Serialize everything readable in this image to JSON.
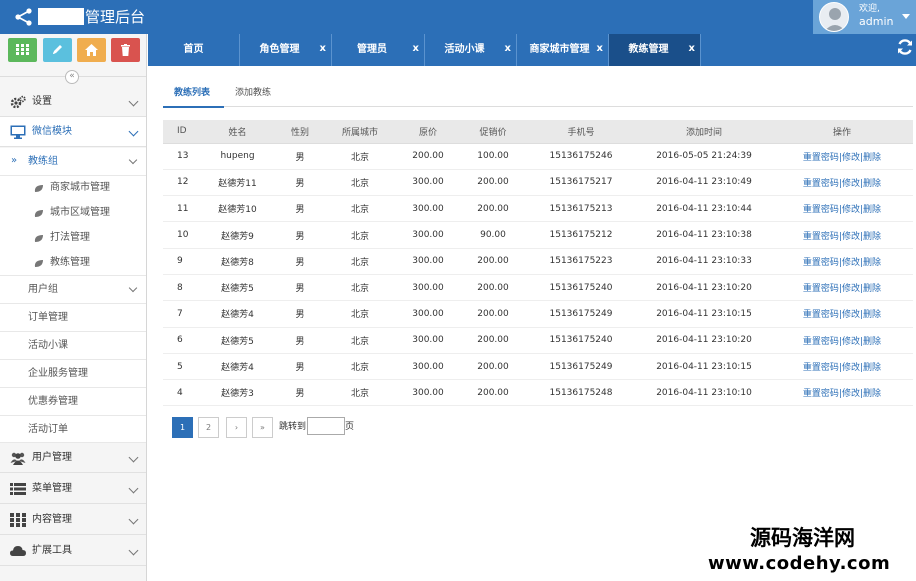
{
  "header": {
    "brand_suffix": "管理后台",
    "user_welcome": "欢迎,",
    "user_name": "admin"
  },
  "colors": {
    "primary": "#2c6fb7",
    "primary_dark": "#1a4f8a",
    "btn_green": "#5cb85c",
    "btn_blue": "#5bc0de",
    "btn_orange": "#f0ad4e",
    "btn_red": "#d9534f"
  },
  "shortcuts": [
    {
      "icon": "grid-icon",
      "color": "#5cb85c"
    },
    {
      "icon": "pencil-icon",
      "color": "#5bc0de"
    },
    {
      "icon": "home-icon",
      "color": "#f0ad4e"
    },
    {
      "icon": "trash-icon",
      "color": "#d9534f"
    }
  ],
  "sidebar": {
    "settings": "设置",
    "wechat": "微信模块",
    "coach_group": "教练组",
    "coach_leaves": [
      "商家城市管理",
      "城市区域管理",
      "打法管理",
      "教练管理"
    ],
    "user_group": "用户组",
    "order_mgmt": "订单管理",
    "activity_class": "活动小课",
    "enterprise_service": "企业服务管理",
    "coupon_mgmt": "优惠券管理",
    "activity_order": "活动订单",
    "user_mgmt": "用户管理",
    "menu_mgmt": "菜单管理",
    "content_mgmt": "内容管理",
    "ext_tools": "扩展工具"
  },
  "tabs": [
    {
      "label": "首页",
      "closable": false
    },
    {
      "label": "角色管理",
      "closable": true
    },
    {
      "label": "管理员",
      "closable": true
    },
    {
      "label": "活动小课",
      "closable": true
    },
    {
      "label": "商家城市管理",
      "closable": true
    },
    {
      "label": "教练管理",
      "closable": true,
      "active": true
    }
  ],
  "tab_close": "x",
  "content_tabs": {
    "list": "教练列表",
    "add": "添加教练"
  },
  "table": {
    "headers": [
      "ID",
      "姓名",
      "性别",
      "所属城市",
      "原价",
      "促销价",
      "手机号",
      "添加时间",
      "操作"
    ],
    "rows": [
      [
        "13",
        "hupeng",
        "男",
        "北京",
        "200.00",
        "100.00",
        "15136175246",
        "2016-05-05 21:24:39"
      ],
      [
        "12",
        "赵德芳11",
        "男",
        "北京",
        "300.00",
        "200.00",
        "15136175217",
        "2016-04-11 23:10:49"
      ],
      [
        "11",
        "赵德芳10",
        "男",
        "北京",
        "300.00",
        "200.00",
        "15136175213",
        "2016-04-11 23:10:44"
      ],
      [
        "10",
        "赵德芳9",
        "男",
        "北京",
        "300.00",
        "90.00",
        "15136175212",
        "2016-04-11 23:10:38"
      ],
      [
        "9",
        "赵德芳8",
        "男",
        "北京",
        "300.00",
        "200.00",
        "15136175223",
        "2016-04-11 23:10:33"
      ],
      [
        "8",
        "赵德芳5",
        "男",
        "北京",
        "300.00",
        "200.00",
        "15136175240",
        "2016-04-11 23:10:20"
      ],
      [
        "7",
        "赵德芳4",
        "男",
        "北京",
        "300.00",
        "200.00",
        "15136175249",
        "2016-04-11 23:10:15"
      ],
      [
        "6",
        "赵德芳5",
        "男",
        "北京",
        "300.00",
        "200.00",
        "15136175240",
        "2016-04-11 23:10:20"
      ],
      [
        "5",
        "赵德芳4",
        "男",
        "北京",
        "300.00",
        "200.00",
        "15136175249",
        "2016-04-11 23:10:15"
      ],
      [
        "4",
        "赵德芳3",
        "男",
        "北京",
        "300.00",
        "200.00",
        "15136175248",
        "2016-04-11 23:10:10"
      ]
    ],
    "op_reset": "重置密码",
    "op_sep": "|",
    "op_edit": "修改",
    "op_delete": "删除"
  },
  "pager": {
    "page1": "1",
    "page2": "2",
    "next": "›",
    "last": "»",
    "jump_prefix": "跳转到",
    "jump_suffix": "页"
  },
  "watermark": {
    "line1": "源码海洋网",
    "line2": "www.codehy.com"
  }
}
